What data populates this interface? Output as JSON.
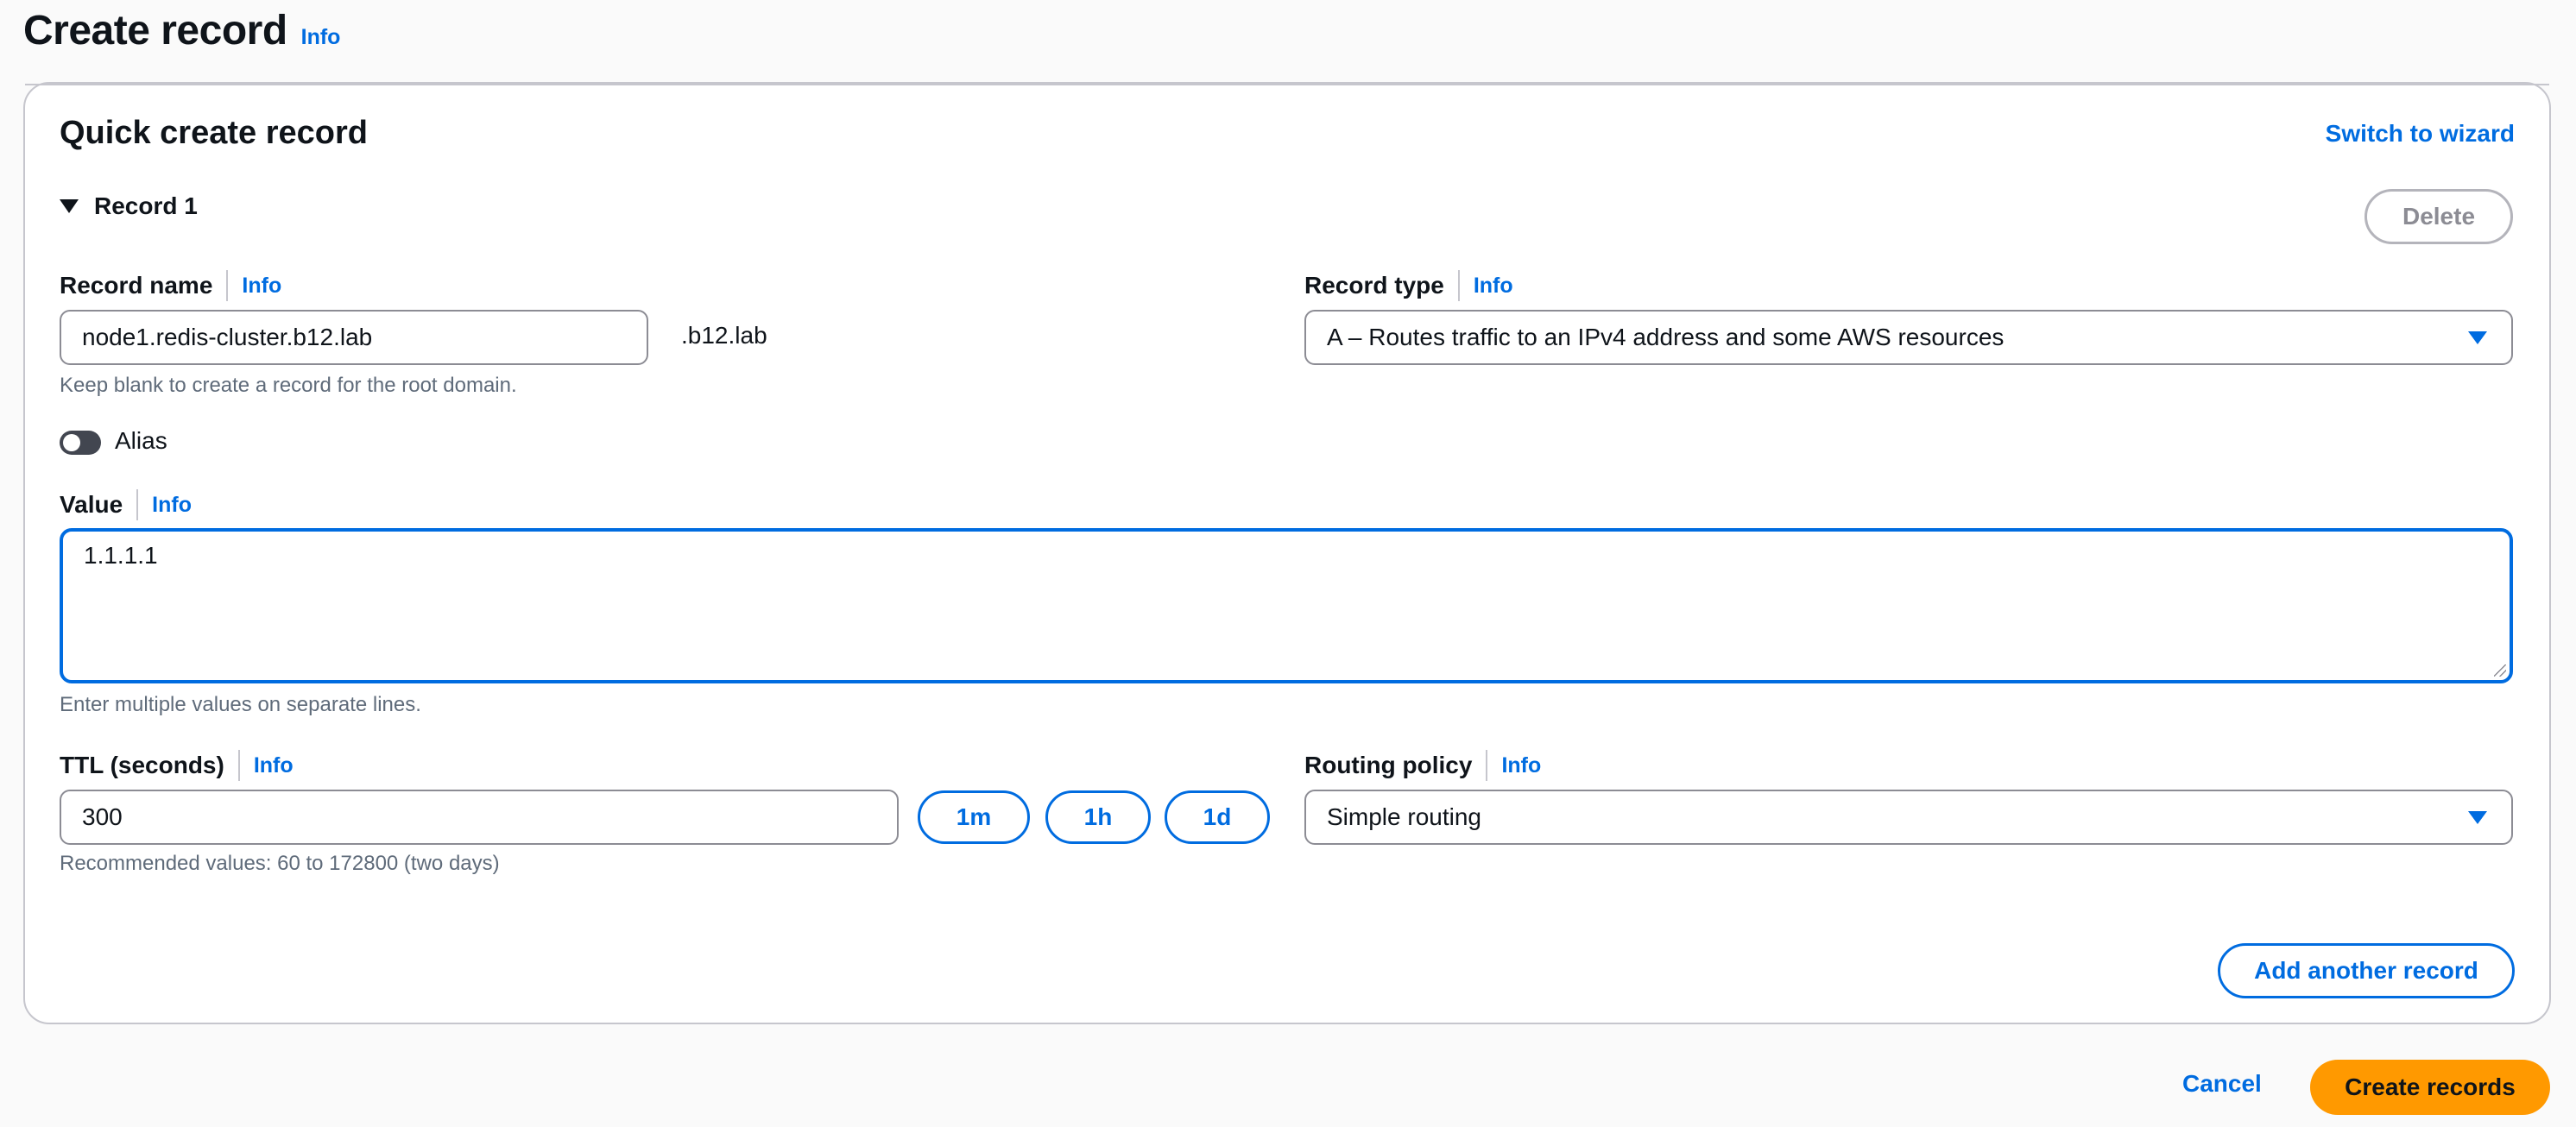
{
  "page": {
    "title": "Create record",
    "info": "Info"
  },
  "panel": {
    "title": "Quick create record",
    "switch_wizard": "Switch to wizard",
    "record_label": "Record 1",
    "delete_label": "Delete"
  },
  "record_name": {
    "label": "Record name",
    "info": "Info",
    "value": "node1.redis-cluster.b12.lab",
    "suffix": ".b12.lab",
    "hint": "Keep blank to create a record for the root domain."
  },
  "record_type": {
    "label": "Record type",
    "info": "Info",
    "selected": "A – Routes traffic to an IPv4 address and some AWS resources"
  },
  "alias": {
    "label": "Alias",
    "enabled": false
  },
  "value": {
    "label": "Value",
    "info": "Info",
    "content": "1.1.1.1",
    "hint": "Enter multiple values on separate lines."
  },
  "ttl": {
    "label": "TTL (seconds)",
    "info": "Info",
    "value": "300",
    "hint": "Recommended values: 60 to 172800 (two days)",
    "presets": [
      "1m",
      "1h",
      "1d"
    ]
  },
  "routing": {
    "label": "Routing policy",
    "info": "Info",
    "selected": "Simple routing"
  },
  "actions": {
    "add_record": "Add another record",
    "cancel": "Cancel",
    "create": "Create records"
  },
  "colors": {
    "accent": "#006ce0",
    "primary_button": "#ff9900",
    "border": "#c6c6cd"
  }
}
